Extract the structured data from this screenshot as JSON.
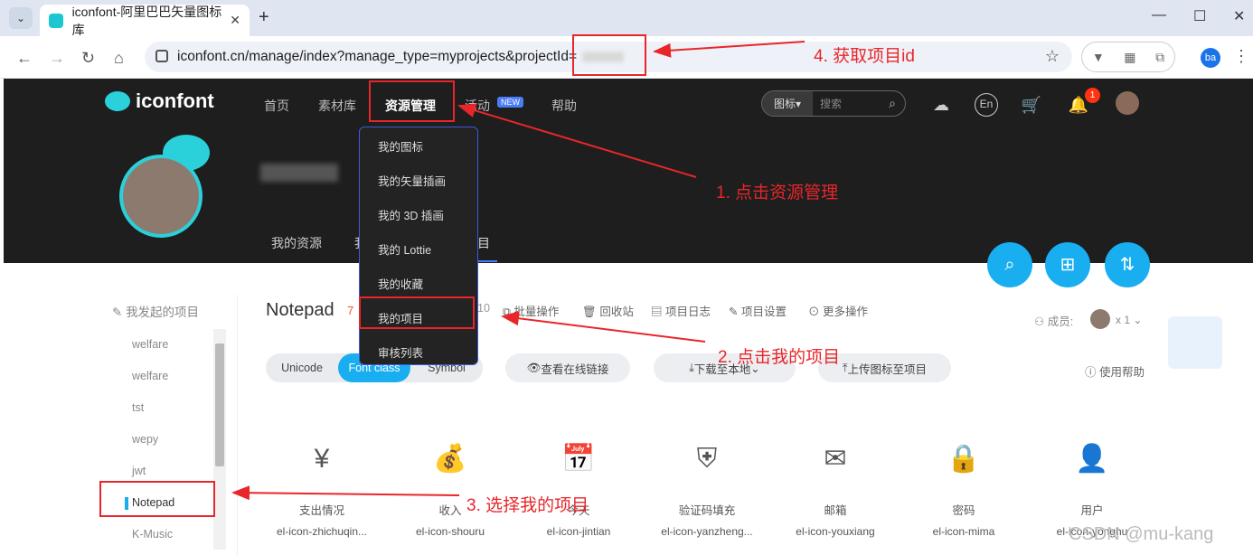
{
  "browser": {
    "tab_title": "iconfont-阿里巴巴矢量图标库",
    "url_text": "iconfont.cn/manage/index?manage_type=myprojects&projectId=",
    "profile_initials": "ba"
  },
  "site": {
    "logo": "iconfont",
    "nav": [
      "首页",
      "素材库",
      "资源管理",
      "活动",
      "帮助"
    ],
    "new_badge": "NEW",
    "search_type": "图标",
    "search_placeholder": "搜索",
    "bell_count": "1",
    "profile_tabs": [
      "我的资源",
      "我",
      "目"
    ]
  },
  "dropdown": [
    "我的图标",
    "我的矢量插画",
    "我的 3D 插画",
    "我的 Lottie",
    "我的收藏",
    "我的项目",
    "审核列表"
  ],
  "sidebar": {
    "title": "我发起的项目",
    "items": [
      "welfare",
      "welfare",
      "tst",
      "wepy",
      "jwt",
      "Notepad",
      "K-Music"
    ]
  },
  "project": {
    "title": "Notepad",
    "count": "7",
    "count2": "10",
    "actions": [
      "批量操作",
      "回收站",
      "项目日志",
      "项目设置",
      "更多操作"
    ],
    "members_label": "成员:",
    "members_count": "x 1",
    "segments": [
      "Unicode",
      "Font class",
      "Symbol"
    ],
    "buttons": [
      "查看在线链接",
      "下载至本地",
      "上传图标至项目"
    ],
    "help": "使用帮助"
  },
  "icons": [
    {
      "name": "支出情况",
      "code": "el-icon-zhichuqin..."
    },
    {
      "name": "收入",
      "code": "el-icon-shouru"
    },
    {
      "name": "今天",
      "code": "el-icon-jintian"
    },
    {
      "name": "验证码填充",
      "code": "el-icon-yanzheng..."
    },
    {
      "name": "邮箱",
      "code": "el-icon-youxiang"
    },
    {
      "name": "密码",
      "code": "el-icon-mima"
    },
    {
      "name": "用户",
      "code": "el-icon-yonghu"
    }
  ],
  "annotations": [
    "1. 点击资源管理",
    "2. 点击我的项目",
    "3. 选择我的项目",
    "4. 获取项目id"
  ],
  "watermark": "CSDN @mu-kang",
  "colors": {
    "accent": "#19aef0",
    "annotation": "#e8262a",
    "header_bg": "#1e1e1e"
  }
}
